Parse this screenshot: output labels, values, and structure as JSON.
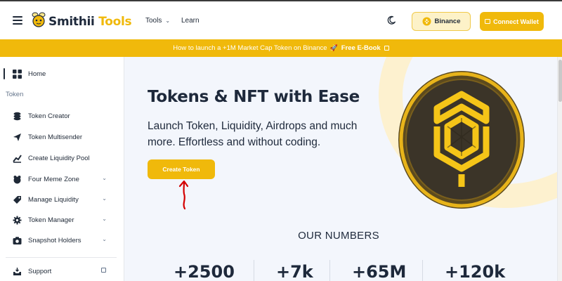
{
  "header": {
    "logo": {
      "name": "Smithii",
      "accent": "Tools"
    },
    "nav": [
      {
        "label": "Tools",
        "has_dropdown": true
      },
      {
        "label": "Learn"
      }
    ],
    "icons": {
      "menu": "hamburger-icon",
      "theme": "moon-icon"
    },
    "binance_button": "Binance",
    "connect_wallet_button": "Connect Wallet"
  },
  "banner": {
    "text": "How to launch a +1M Market Cap Token on Binance",
    "emoji": "🚀",
    "link_text": "Free E-Book"
  },
  "sidebar": {
    "section_label": "Token",
    "items": [
      {
        "label": "Home",
        "icon": "grid-icon",
        "active": true
      },
      {
        "label": "Token Creator",
        "icon": "coins-icon"
      },
      {
        "label": "Token Multisender",
        "icon": "send-icon"
      },
      {
        "label": "Create Liquidity Pool",
        "icon": "chart-icon"
      },
      {
        "label": "Four Meme Zone",
        "icon": "frog-icon",
        "has_dropdown": true
      },
      {
        "label": "Manage Liquidity",
        "icon": "tag-icon",
        "has_dropdown": true
      },
      {
        "label": "Token Manager",
        "icon": "gear-icon",
        "has_dropdown": true
      },
      {
        "label": "Snapshot Holders",
        "icon": "camera-icon",
        "has_dropdown": true
      },
      {
        "label": "Support",
        "icon": "inbox-icon",
        "external": true
      }
    ]
  },
  "hero": {
    "title": "Tokens & NFT with Ease",
    "subtitle": "Launch Token, Liquidity, Airdrops and much more. Effortless and without coding.",
    "cta": "Create Token"
  },
  "numbers": {
    "title": "OUR NUMBERS",
    "stats": [
      "+2500",
      "+7k",
      "+65M",
      "+120k"
    ]
  },
  "colors": {
    "brand": "#f0b90b",
    "brand_light": "#fdf2c8",
    "text_dark": "#1e293b",
    "main_bg": "#f3f6fc",
    "annotation": "#d40000"
  }
}
